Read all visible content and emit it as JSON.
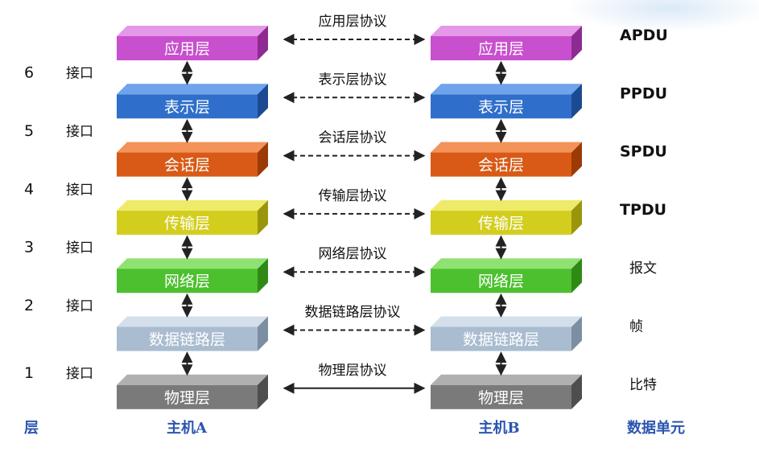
{
  "layers": [
    {
      "name": "应用层",
      "protocol": "应用层协议",
      "pdu": "APDU",
      "color": "#c84fcd",
      "top": "#e597e8",
      "side": "#8e2b93",
      "text": "#ffffff"
    },
    {
      "name": "表示层",
      "protocol": "表示层协议",
      "pdu": "PPDU",
      "color": "#2f6fcb",
      "top": "#6fa4ec",
      "side": "#1c4a92",
      "text": "#ffffff"
    },
    {
      "name": "会话层",
      "protocol": "会话层协议",
      "pdu": "SPDU",
      "color": "#d85a16",
      "top": "#f3935a",
      "side": "#9c3a06",
      "text": "#ffffff"
    },
    {
      "name": "传输层",
      "protocol": "传输层协议",
      "pdu": "TPDU",
      "color": "#d3ce1e",
      "top": "#efeb6a",
      "side": "#9a960c",
      "text": "#ffffff"
    },
    {
      "name": "网络层",
      "protocol": "网络层协议",
      "pdu": "报文",
      "color": "#4cc02e",
      "top": "#8fe272",
      "side": "#2e8a15",
      "text": "#ffffff"
    },
    {
      "name": "数据链路层",
      "protocol": "数据链路层协议",
      "pdu": "帧",
      "color": "#a9bcd0",
      "top": "#d3dfea",
      "side": "#7c8ea2",
      "text": "#ffffff"
    },
    {
      "name": "物理层",
      "protocol": "物理层协议",
      "pdu": "比特",
      "color": "#7a7a7a",
      "top": "#b0b0b0",
      "side": "#4e4e4e",
      "text": "#ffffff"
    }
  ],
  "interfaces": [
    {
      "num": "6",
      "label": "接口"
    },
    {
      "num": "5",
      "label": "接口"
    },
    {
      "num": "4",
      "label": "接口"
    },
    {
      "num": "3",
      "label": "接口"
    },
    {
      "num": "2",
      "label": "接口"
    },
    {
      "num": "1",
      "label": "接口"
    }
  ],
  "footer": {
    "layer_label": "层",
    "host_a": "主机A",
    "host_b": "主机B",
    "data_unit": "数据单元"
  },
  "colors": {
    "footer_text": "#2a55b0",
    "label_text": "#111111",
    "arrow": "#222222"
  }
}
